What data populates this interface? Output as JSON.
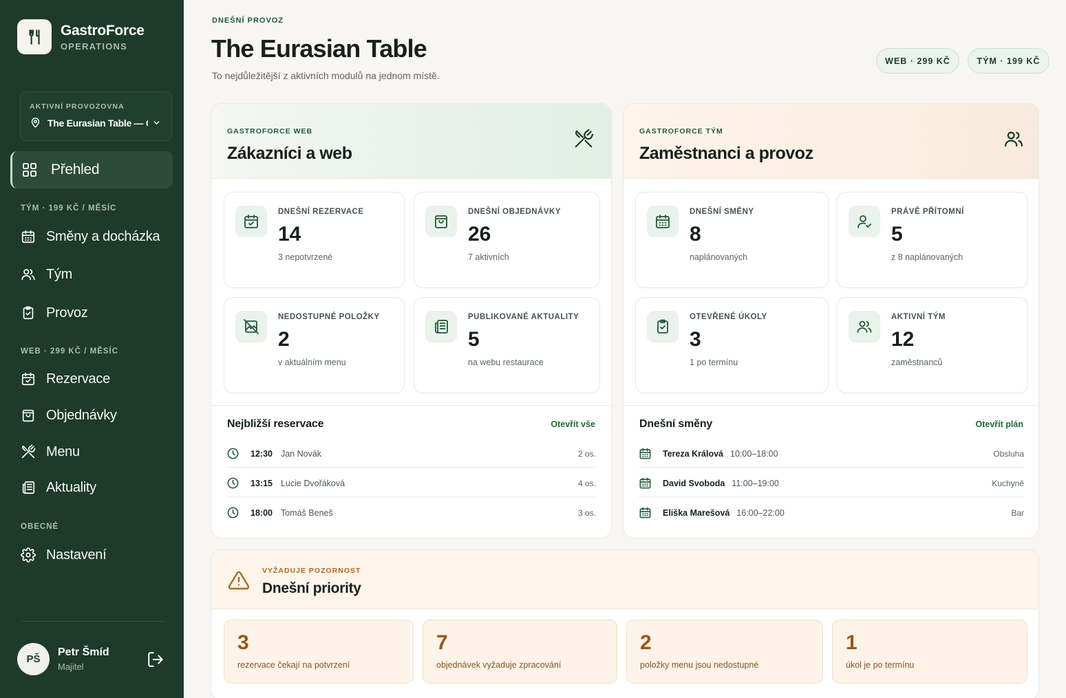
{
  "brand": {
    "name": "GastroForce",
    "subtitle": "OPERATIONS"
  },
  "location": {
    "label": "AKTIVNÍ PROVOZOVNA",
    "value": "The Eurasian Table — Č"
  },
  "nav": {
    "overview": "Přehled",
    "section_team": "TÝM · 199 KČ / MĚSÍC",
    "shifts": "Směny a docházka",
    "team": "Tým",
    "operations": "Provoz",
    "section_web": "WEB · 299 KČ / MĚSÍC",
    "reservations": "Rezervace",
    "orders": "Objednávky",
    "menu": "Menu",
    "news": "Aktuality",
    "section_general": "OBECNÉ",
    "settings": "Nastavení"
  },
  "user": {
    "initials": "PŠ",
    "name": "Petr Šmíd",
    "role": "Majitel"
  },
  "header": {
    "eyebrow": "DNEŠNÍ PROVOZ",
    "title": "The Eurasian Table",
    "subtitle": "To nejdůležitější z aktivních modulů na jednom místě.",
    "plan_web": "WEB · 299 KČ",
    "plan_team": "TÝM · 199 KČ"
  },
  "web_panel": {
    "eyebrow": "GASTROFORCE WEB",
    "title": "Zákazníci a web",
    "stats": [
      {
        "label": "DNEŠNÍ REZERVACE",
        "value": "14",
        "note": "3 nepotvrzené"
      },
      {
        "label": "DNEŠNÍ OBJEDNÁVKY",
        "value": "26",
        "note": "7 aktivních"
      },
      {
        "label": "NEDOSTUPNÉ POLOŽKY",
        "value": "2",
        "note": "v aktuálním menu"
      },
      {
        "label": "PUBLIKOVANÉ AKTUALITY",
        "value": "5",
        "note": "na webu restaurace"
      }
    ],
    "list_title": "Nejbližší reservace",
    "list_link": "Otevřít vše",
    "rows": [
      {
        "time": "12:30",
        "name": "Jan Novák",
        "guests": "2 os."
      },
      {
        "time": "13:15",
        "name": "Lucie Dvořáková",
        "guests": "4 os."
      },
      {
        "time": "18:00",
        "name": "Tomáš Beneš",
        "guests": "3 os."
      }
    ]
  },
  "team_panel": {
    "eyebrow": "GASTROFORCE TÝM",
    "title": "Zaměstnanci a provoz",
    "stats": [
      {
        "label": "DNEŠNÍ SMĚNY",
        "value": "8",
        "note": "naplánovaných"
      },
      {
        "label": "PRÁVĚ PŘÍTOMNÍ",
        "value": "5",
        "note": "z 8 naplánovaných"
      },
      {
        "label": "OTEVŘENÉ ÚKOLY",
        "value": "3",
        "note": "1 po termínu"
      },
      {
        "label": "AKTIVNÍ TÝM",
        "value": "12",
        "note": "zaměstnanců"
      }
    ],
    "list_title": "Dnešní směny",
    "list_link": "Otevřít plán",
    "rows": [
      {
        "name": "Tereza Králová",
        "time": "10:00–18:00",
        "role": "Obsluha"
      },
      {
        "name": "David Svoboda",
        "time": "11:00–19:00",
        "role": "Kuchyně"
      },
      {
        "name": "Eliška Marešová",
        "time": "16:00–22:00",
        "role": "Bar"
      }
    ]
  },
  "priorities": {
    "eyebrow": "VYŽADUJE POZORNOST",
    "title": "Dnešní priority",
    "items": [
      {
        "value": "3",
        "text": "rezervace čekají na potvrzení"
      },
      {
        "value": "7",
        "text": "objednávek vyžaduje zpracování"
      },
      {
        "value": "2",
        "text": "položky menu jsou nedostupné"
      },
      {
        "value": "1",
        "text": "úkol je po termínu"
      }
    ]
  }
}
